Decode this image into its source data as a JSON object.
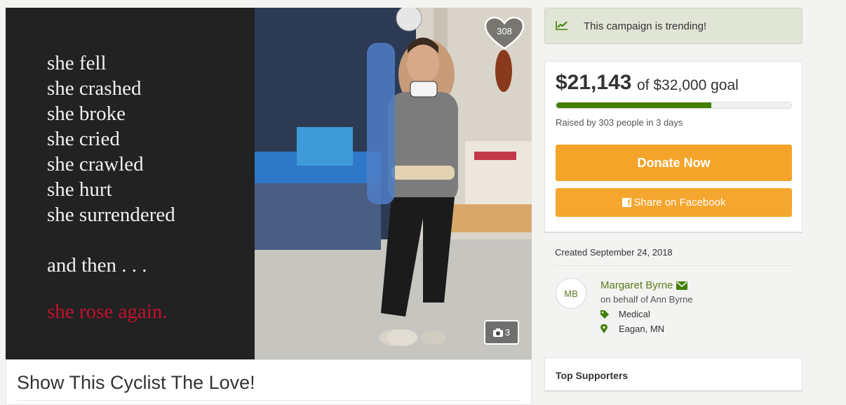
{
  "hero": {
    "poem": [
      "she fell",
      "she crashed",
      "she broke",
      "she cried",
      "she crawled",
      "she hurt",
      "she surrendered",
      "and then . . .",
      "she rose again."
    ],
    "heart_count": "308",
    "photo_count": "3"
  },
  "campaign": {
    "title": "Show This Cyclist The Love!"
  },
  "trending": {
    "text": "This campaign is trending!"
  },
  "donation": {
    "amount": "$21,143",
    "goal_text": "of $32,000 goal",
    "progress_fraction": 0.66,
    "raised_text": "Raised by 303 people in 3 days",
    "donate_label": "Donate Now",
    "share_label": "Share on Facebook"
  },
  "organizer": {
    "created": "Created September 24, 2018",
    "initials": "MB",
    "name": "Margaret Byrne",
    "behalf": "on behalf of Ann Byrne",
    "category": "Medical",
    "location": "Eagan, MN"
  },
  "supporters": {
    "title": "Top Supporters"
  },
  "colors": {
    "accent_orange": "#f5a623",
    "progress_green": "#447e03",
    "link_green": "#5a7a1d",
    "trending_bg": "#e1e5d6"
  },
  "icons": [
    "trending-chart-icon",
    "heart-icon",
    "camera-icon",
    "facebook-icon",
    "envelope-icon",
    "tag-icon",
    "map-marker-icon"
  ]
}
